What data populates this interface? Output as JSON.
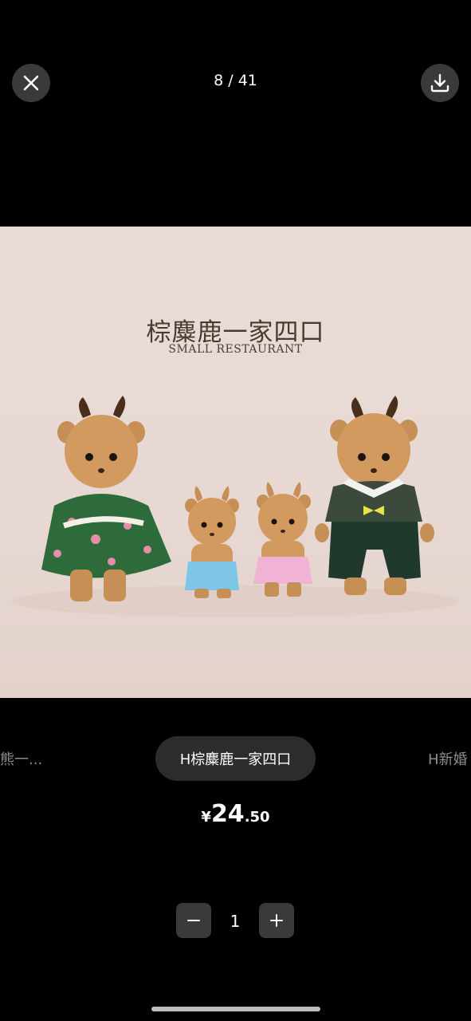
{
  "viewer": {
    "counter": "8 / 41",
    "close_icon": "close-icon",
    "download_icon": "download-icon"
  },
  "image": {
    "title": "棕麋鹿一家四口",
    "subtitle": "SMALL RESTAURANT"
  },
  "variants": {
    "prev_label": "熊一...",
    "active_label": "H棕麋鹿一家四口",
    "next_label": "H新婚"
  },
  "price": {
    "symbol": "¥",
    "integer": "24",
    "decimal": ".50"
  },
  "quantity": {
    "value": "1",
    "minus_icon": "minus-icon",
    "plus_icon": "plus-icon"
  },
  "colors": {
    "background": "#000000",
    "button_bg": "#3a3a3c",
    "chip_bg": "#2c2c2e",
    "inactive_text": "#8e8e93"
  }
}
